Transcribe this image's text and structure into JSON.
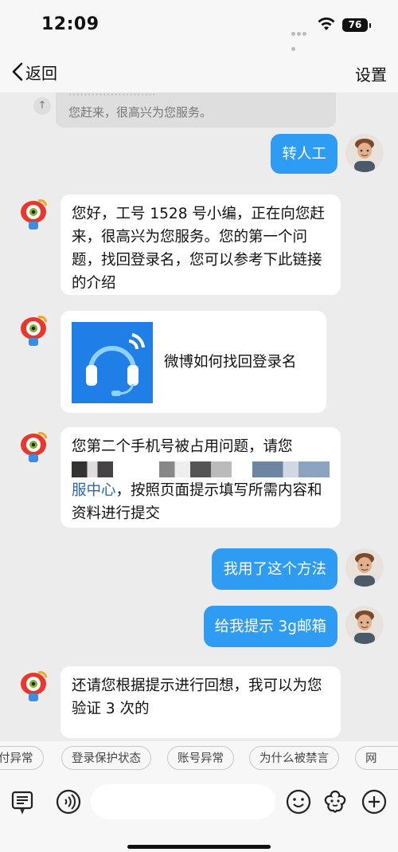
{
  "status": {
    "time": "12:09",
    "battery": "76"
  },
  "nav": {
    "back_label": "返回",
    "settings_label": "设置"
  },
  "system_card": {
    "line1": "·······················",
    "line2": "您赶来，很高兴为您服务。"
  },
  "messages": {
    "user1": "转人工",
    "bot1": "您好，工号 1528 号小编，正在向您赶来，很高兴为您服务。您的第一个问题，找回登录名，您可以参考下此链接的介绍",
    "link_title": "微博如何找回登录名",
    "bot2_line1": "您第二个手机号被占用问题，请您",
    "bot2_link": "服中心",
    "bot2_rest": "，按照页面提示填写所需内容和资料进行提交",
    "user2": "我用了这个方法",
    "user3": "给我提示 3g邮箱",
    "bot3": "还请您根据提示进行回想，我可以为您验证 3 次的"
  },
  "quick_chips": [
    "付异常",
    "登录保护状态",
    "账号异常",
    "为什么被禁言",
    "网"
  ],
  "colors": {
    "accent": "#2d9cf2",
    "link": "#2a67b0",
    "background": "#ececec"
  }
}
